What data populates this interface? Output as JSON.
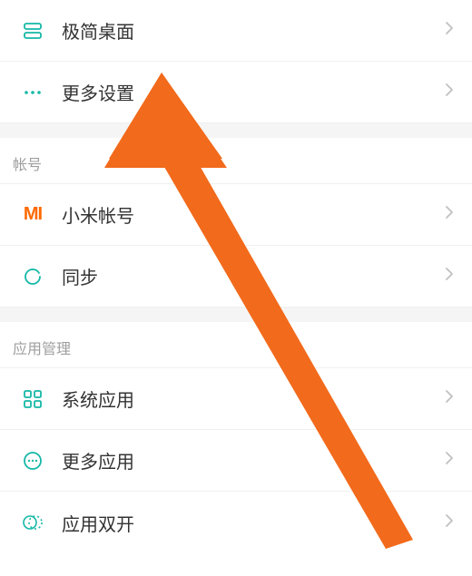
{
  "top_group": {
    "simple_desktop": "极简桌面",
    "more_settings": "更多设置"
  },
  "sections": {
    "account": {
      "header": "帐号",
      "xiaomi_account": "小米帐号",
      "sync": "同步"
    },
    "app_management": {
      "header": "应用管理",
      "system_apps": "系统应用",
      "more_apps": "更多应用",
      "dual_apps": "应用双开"
    }
  },
  "colors": {
    "accent_teal": "#14b8a6",
    "mi_orange": "#ff6900",
    "arrow_orange": "#f26a1b",
    "chevron_gray": "#c0c0c0"
  }
}
